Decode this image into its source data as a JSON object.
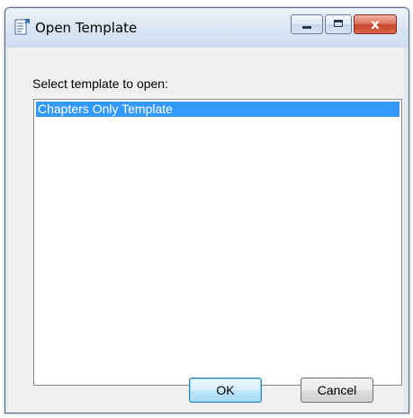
{
  "window": {
    "title": "Open Template",
    "title_icon": "template-document-icon",
    "controls": {
      "minimize_icon": "minimize-icon",
      "maximize_icon": "maximize-icon",
      "close_glyph": "x"
    }
  },
  "dialog": {
    "prompt": "Select template to open:",
    "templates": [
      {
        "label": "Chapters Only Template",
        "selected": true
      }
    ],
    "buttons": {
      "ok_label": "OK",
      "cancel_label": "Cancel"
    }
  },
  "colors": {
    "selection": "#3399ff",
    "close_button": "#c8442a",
    "ok_focus_border": "#3c7fb1"
  }
}
